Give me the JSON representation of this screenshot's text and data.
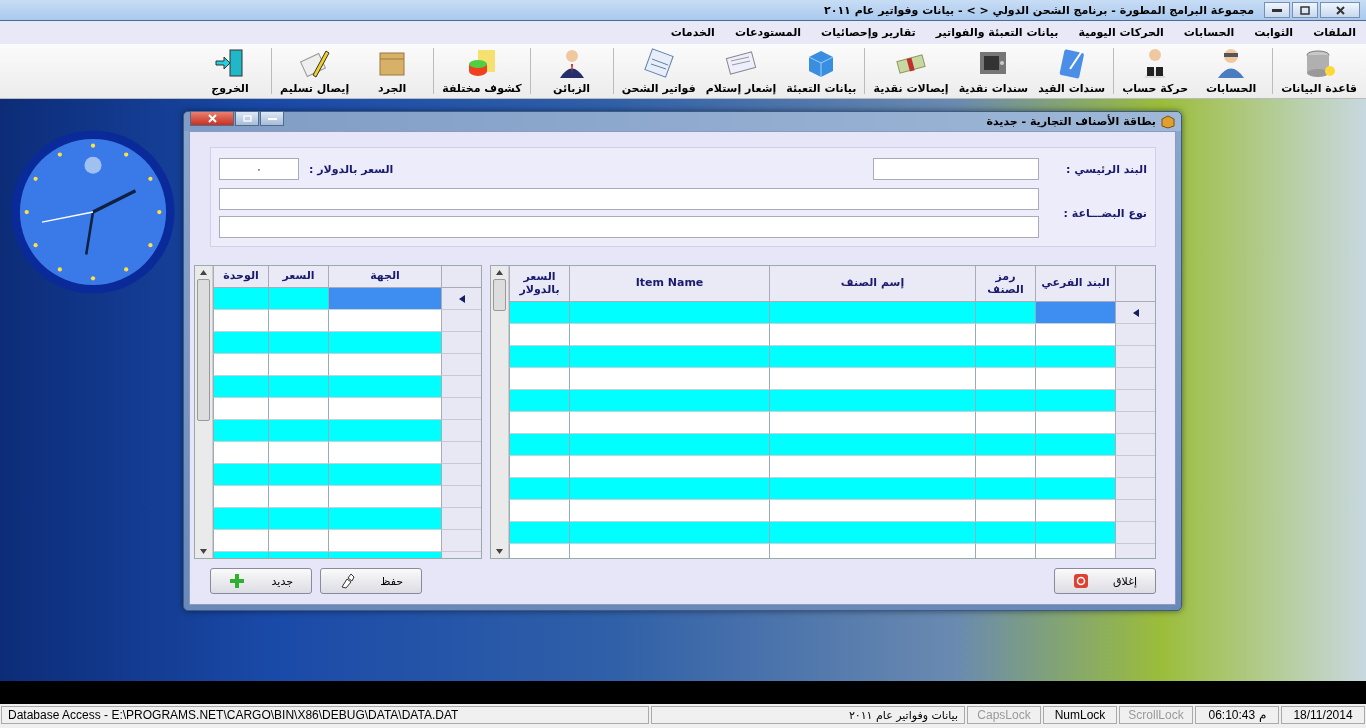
{
  "window": {
    "title": "مجموعة البرامج المطورة - برنامج الشحن الدولي < > - بيانات وفواتير عام ٢٠١١"
  },
  "menu": [
    "الملفات",
    "الثوابت",
    "الحسابات",
    "الحركات اليومية",
    "بيانات التعبئة والفواتير",
    "تقارير وإحصائيات",
    "المستودعات",
    "الخدمات"
  ],
  "toolbar": {
    "groups": [
      [
        "قاعدة البيانات"
      ],
      [
        "الحسابات",
        "حركة حساب"
      ],
      [
        "سندات القيد",
        "سندات نقدية",
        "إيصالات نقدية"
      ],
      [
        "بيانات التعبئة",
        "إشعار إستلام",
        "فواتير الشحن"
      ],
      [
        "الزبائن"
      ],
      [
        "كشوف مختلفة"
      ],
      [
        "الجرد",
        "إيصال تسليم"
      ],
      [
        "الخروج"
      ]
    ]
  },
  "dialog": {
    "title": "بطاقة الأصناف التجارية - جديدة",
    "main_item": {
      "label": "البند الرئيسي :"
    },
    "price": {
      "label": "السعر بالدولار :",
      "value": "٠"
    },
    "goods_type": {
      "label": "نوع البضـــاعة :"
    },
    "items_grid": {
      "columns": [
        "البند الفرعي",
        "رمز الصنف",
        "إسم الصنف",
        "Item Name",
        "السعر بالدولار"
      ],
      "rows": [
        {
          "selected": true
        },
        {
          "selected": false
        },
        {
          "selected": false
        },
        {
          "selected": false
        },
        {
          "selected": false
        },
        {
          "selected": false
        },
        {
          "selected": false
        },
        {
          "selected": false
        },
        {
          "selected": false
        },
        {
          "selected": false
        },
        {
          "selected": false
        },
        {
          "selected": false
        }
      ]
    },
    "prices_grid": {
      "columns": [
        "الجهة",
        "السعر",
        "الوحدة"
      ],
      "rows": [
        {
          "selected": true
        },
        {
          "selected": false
        },
        {
          "selected": false
        },
        {
          "selected": false
        },
        {
          "selected": false
        },
        {
          "selected": false
        },
        {
          "selected": false
        },
        {
          "selected": false
        },
        {
          "selected": false
        },
        {
          "selected": false
        },
        {
          "selected": false
        },
        {
          "selected": false
        },
        {
          "selected": false
        }
      ]
    },
    "buttons": {
      "close": "إغلاق",
      "save": "حفظ",
      "new": "جديد"
    }
  },
  "status_bar": {
    "path": "Database Access - E:\\PROGRAMS.NET\\CARGO\\BIN\\X86\\DEBUG\\DATA\\DATA.DAT",
    "year": "بيانات وفواتير عام ٢٠١١",
    "caps_lock": {
      "label": "CapsLock",
      "on": false
    },
    "num_lock": {
      "label": "NumLock",
      "on": true
    },
    "scroll_lock": {
      "label": "ScrollLock",
      "on": false
    },
    "time": "06:10:43 م",
    "date": "18/11/2014"
  }
}
